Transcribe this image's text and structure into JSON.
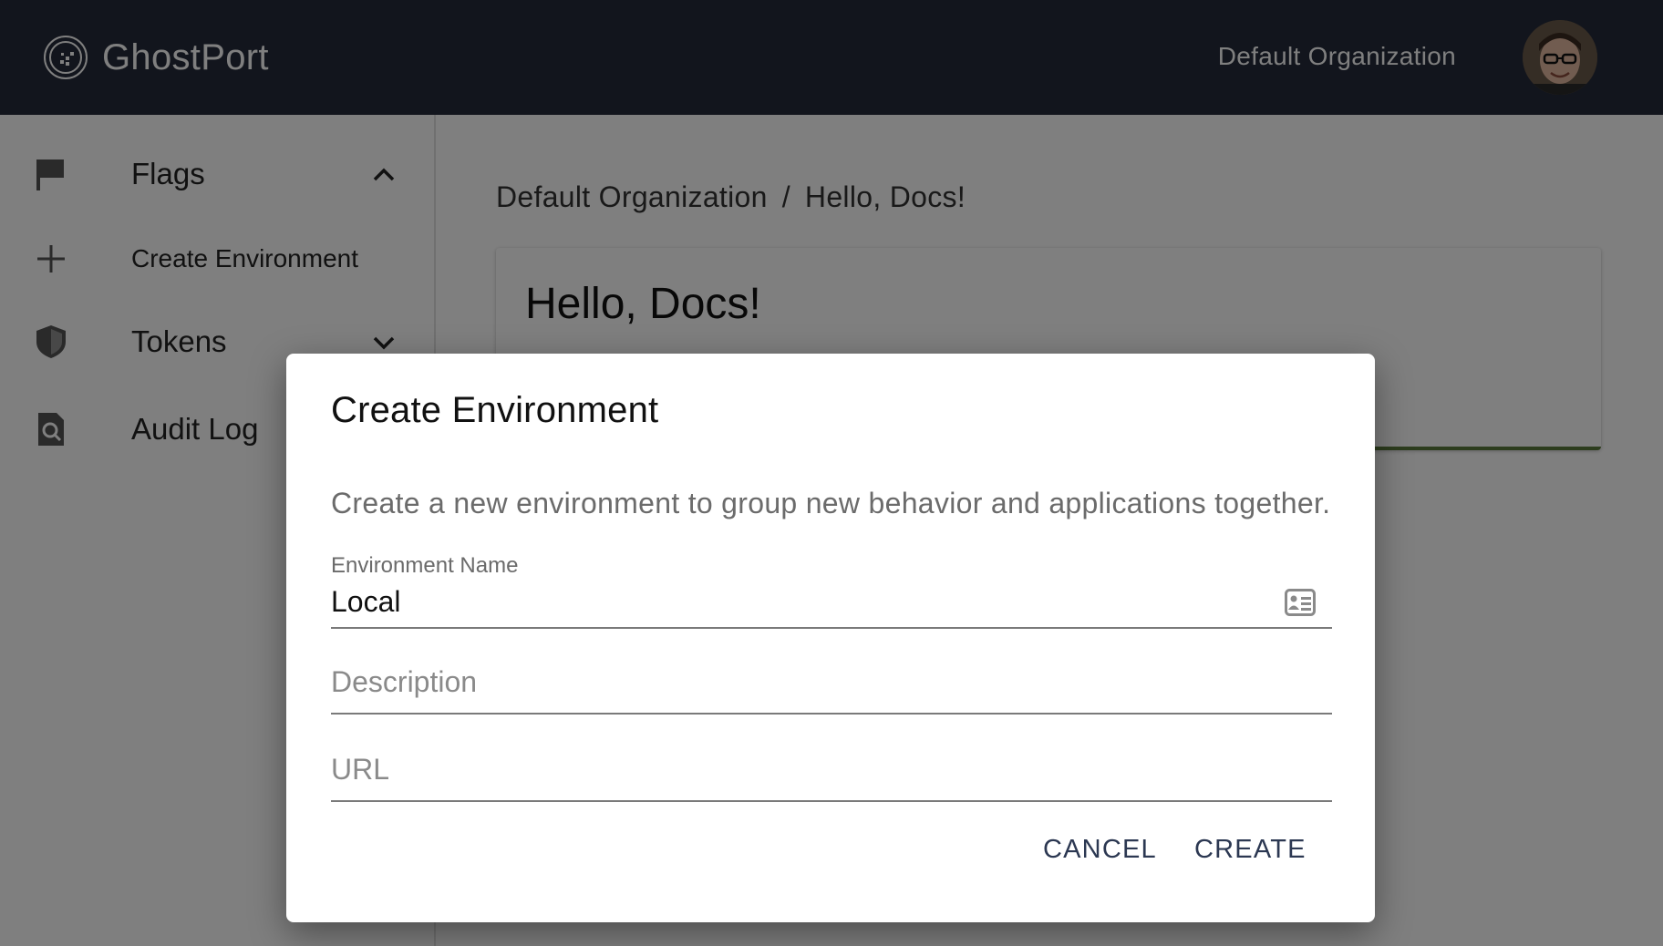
{
  "app": {
    "brand": "GhostPort",
    "organization": "Default Organization"
  },
  "sidebar": {
    "items": [
      {
        "label": "Flags",
        "icon": "flag-icon",
        "chevron": "chevron-up-icon"
      },
      {
        "label": "Create Environment",
        "icon": "plus-icon"
      },
      {
        "label": "Tokens",
        "icon": "shield-icon",
        "chevron": "chevron-down-icon"
      },
      {
        "label": "Audit Log",
        "icon": "search-document-icon"
      }
    ]
  },
  "breadcrumb": {
    "org": "Default Organization",
    "separator": "/",
    "current": "Hello, Docs!"
  },
  "card": {
    "title": "Hello, Docs!"
  },
  "dialog": {
    "title": "Create Environment",
    "description": "Create a new environment to group new behavior and applications together.",
    "fields": {
      "name": {
        "label": "Environment Name",
        "value": "Local",
        "icon": "contact-card-icon"
      },
      "description": {
        "placeholder": "Description",
        "value": ""
      },
      "url": {
        "placeholder": "URL",
        "value": ""
      }
    },
    "cancel_label": "CANCEL",
    "create_label": "CREATE"
  },
  "colors": {
    "topbar": "#252b3a",
    "button_text": "#2c3852",
    "card_accent": "#5a7a3c"
  }
}
